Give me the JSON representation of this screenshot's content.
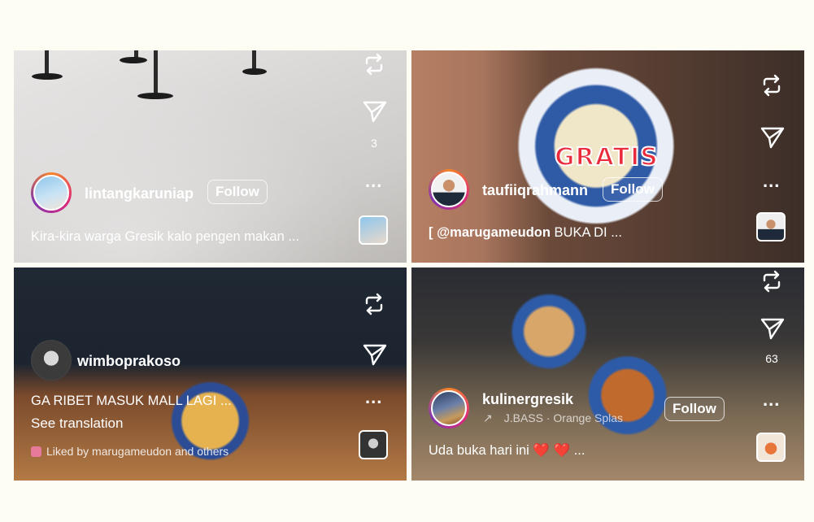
{
  "posts": [
    {
      "username": "lintangkaruniap",
      "follow_label": "Follow",
      "caption": "Kira-kira warga Gresik kalo pengen makan ...",
      "send_count": "3",
      "more_label": "..."
    },
    {
      "username": "taufiiqrahmann",
      "follow_label": "Follow",
      "caption_mention": "[ @marugameudon",
      "caption_rest": " BUKA DI ...",
      "overlay_text": "GRATIS",
      "more_label": "..."
    },
    {
      "username": "wimboprakoso",
      "caption": "GA RIBET MASUK MALL LAGI ...",
      "see_translation": "See translation",
      "liked_by": "Liked by marugameudon and others",
      "more_label": "..."
    },
    {
      "username": "kulinergresik",
      "follow_label": "Follow",
      "audio": "J.BASS · Orange Splas",
      "caption_text": "Uda buka hari ini ",
      "caption_hearts": "❤️ ❤️",
      "caption_ellipsis": " ...",
      "send_count": "63",
      "more_label": "..."
    }
  ],
  "colors": {
    "page_background": "#fefdf3",
    "story_ring": "#dd2a7b",
    "heart": "#e0162b"
  },
  "icons": [
    "repost-icon",
    "send-icon",
    "more-icon",
    "audio-arrow-icon",
    "heart-icon"
  ]
}
